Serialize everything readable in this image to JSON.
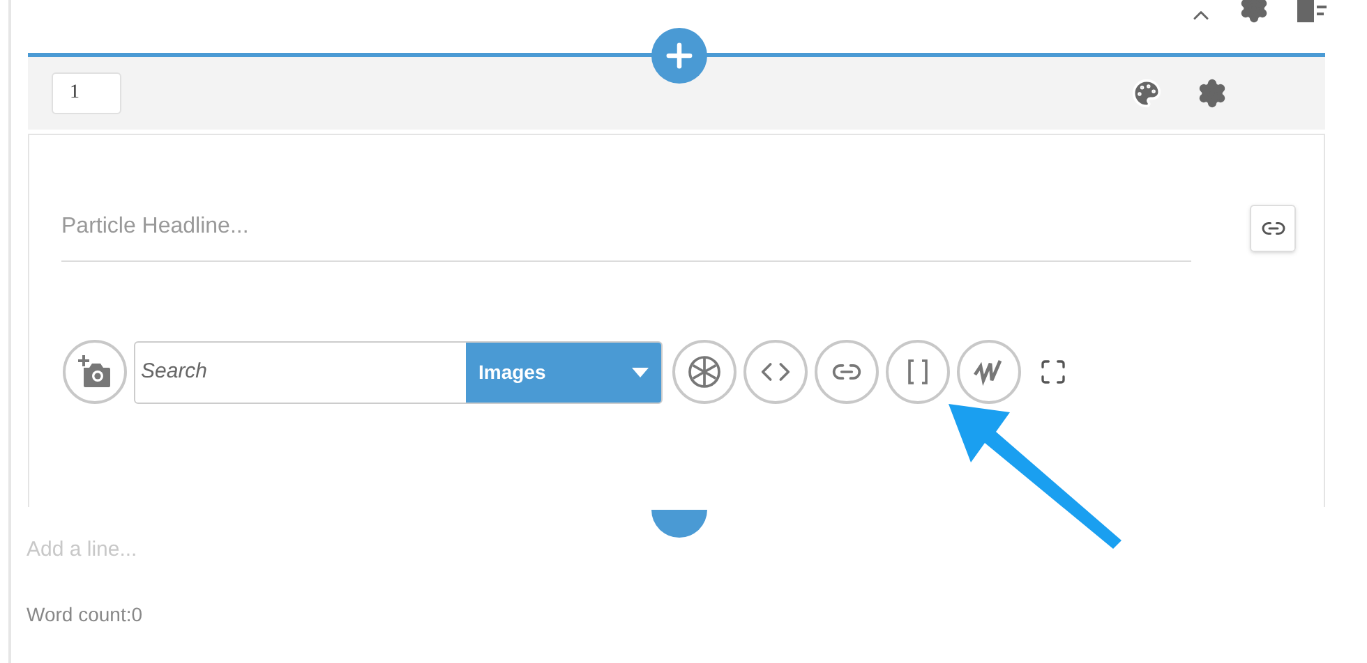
{
  "block": {
    "number": "1",
    "headline_placeholder": "Particle Headline...",
    "search_placeholder": "Search",
    "search_type": "Images"
  },
  "add_line_placeholder": "Add a line...",
  "word_count": "Word count:0"
}
